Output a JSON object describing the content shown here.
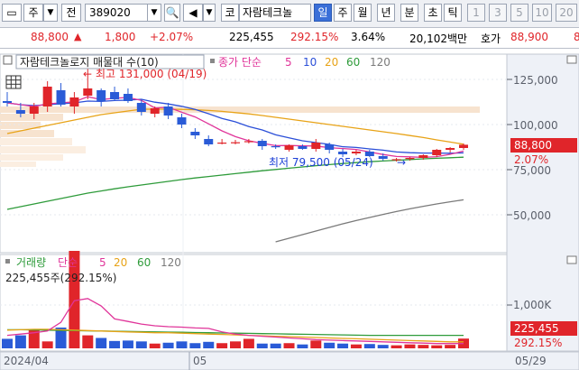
{
  "toolbar": {
    "market": "주",
    "market_sub": "전",
    "code": "389020",
    "name": "자람테크놀",
    "periods": [
      "일",
      "주",
      "월",
      "년",
      "분",
      "초",
      "틱"
    ],
    "selected_period": "일",
    "kind_label": "코",
    "minutes": [
      "1",
      "3",
      "5",
      "10",
      "20"
    ]
  },
  "quote": {
    "price": "88,800",
    "change": "1,800",
    "change_pct": "+2.07%",
    "volume": "225,455",
    "volume_ratio": "292.15%",
    "turnover": "3.64%",
    "amount": "20,102백만",
    "ask_label": "호가",
    "ask_price": "88,900",
    "ask_tail": "8"
  },
  "price_panel": {
    "title": "자람테크놀로지 매물대 수(10)",
    "ma_label": "종가 단순",
    "ma_periods": [
      "5",
      "10",
      "20",
      "60",
      "120"
    ],
    "high_note": "최고 131,000 (04/19)",
    "low_note": "최저 79,500 (05/24)",
    "last_price": "88,800",
    "last_pct": "2.07%",
    "y_ticks": [
      "125,000",
      "100,000",
      "75,000",
      "50,000"
    ]
  },
  "volume_panel": {
    "title": "거래량",
    "ma_label": "단순",
    "ma_periods": [
      "5",
      "20",
      "60",
      "120"
    ],
    "summary": "225,455주(292.15%)",
    "y_tick": "1,000K",
    "last_volume": "225,455",
    "last_pct": "292.15%"
  },
  "x_axis": {
    "labels": [
      "2024/04",
      "05",
      "05/29"
    ]
  },
  "colors": {
    "up": "#e0252a",
    "down": "#2a5bd7",
    "ma5": "#e0359a",
    "ma10": "#2b4fd8",
    "ma20": "#e8a317",
    "ma60": "#2e9b3a",
    "ma120": "#7a7a7a"
  },
  "chart_data": {
    "type": "candlestick",
    "candles": [
      {
        "o": 113000,
        "h": 118000,
        "l": 110000,
        "c": 112000
      },
      {
        "o": 108000,
        "h": 112000,
        "l": 104000,
        "c": 106000
      },
      {
        "o": 106000,
        "h": 112000,
        "l": 103000,
        "c": 110000
      },
      {
        "o": 110000,
        "h": 124000,
        "l": 107000,
        "c": 121000
      },
      {
        "o": 119000,
        "h": 123000,
        "l": 110000,
        "c": 111000
      },
      {
        "o": 110000,
        "h": 118000,
        "l": 106000,
        "c": 115000
      },
      {
        "o": 116000,
        "h": 131000,
        "l": 114000,
        "c": 120000
      },
      {
        "o": 119000,
        "h": 120000,
        "l": 110000,
        "c": 113000
      },
      {
        "o": 118000,
        "h": 121000,
        "l": 113000,
        "c": 114000
      },
      {
        "o": 117000,
        "h": 120000,
        "l": 112000,
        "c": 113000
      },
      {
        "o": 112000,
        "h": 114000,
        "l": 105000,
        "c": 107000
      },
      {
        "o": 106000,
        "h": 110000,
        "l": 104000,
        "c": 109000
      },
      {
        "o": 110000,
        "h": 112000,
        "l": 103000,
        "c": 105000
      },
      {
        "o": 104000,
        "h": 106000,
        "l": 98000,
        "c": 100000
      },
      {
        "o": 96000,
        "h": 98000,
        "l": 92000,
        "c": 94000
      },
      {
        "o": 92000,
        "h": 94000,
        "l": 88000,
        "c": 89000
      },
      {
        "o": 90000,
        "h": 92000,
        "l": 89000,
        "c": 90000
      },
      {
        "o": 90000,
        "h": 91500,
        "l": 89000,
        "c": 90200
      },
      {
        "o": 90500,
        "h": 92000,
        "l": 89500,
        "c": 90800
      },
      {
        "o": 91000,
        "h": 92000,
        "l": 86000,
        "c": 88000
      },
      {
        "o": 88000,
        "h": 89000,
        "l": 86500,
        "c": 87500
      },
      {
        "o": 86000,
        "h": 89000,
        "l": 85000,
        "c": 88500
      },
      {
        "o": 88000,
        "h": 89000,
        "l": 86000,
        "c": 86500
      },
      {
        "o": 86500,
        "h": 92000,
        "l": 85000,
        "c": 90000
      },
      {
        "o": 89000,
        "h": 90000,
        "l": 84000,
        "c": 86000
      },
      {
        "o": 85000,
        "h": 86500,
        "l": 82000,
        "c": 83500
      },
      {
        "o": 84000,
        "h": 86000,
        "l": 83000,
        "c": 85000
      },
      {
        "o": 85000,
        "h": 86000,
        "l": 82000,
        "c": 82500
      },
      {
        "o": 82500,
        "h": 84000,
        "l": 80000,
        "c": 81000
      },
      {
        "o": 80500,
        "h": 81500,
        "l": 79500,
        "c": 80800
      },
      {
        "o": 81000,
        "h": 82000,
        "l": 80000,
        "c": 81500
      },
      {
        "o": 81500,
        "h": 83500,
        "l": 80500,
        "c": 83000
      },
      {
        "o": 83000,
        "h": 86500,
        "l": 82000,
        "c": 86000
      },
      {
        "o": 86000,
        "h": 87500,
        "l": 84500,
        "c": 87000
      },
      {
        "o": 87000,
        "h": 89500,
        "l": 86000,
        "c": 88800
      }
    ],
    "ma5": [
      112000,
      111000,
      110000,
      111500,
      112000,
      112600,
      115400,
      113800,
      114600,
      115000,
      113400,
      109200,
      109600,
      106800,
      104200,
      100400,
      96500,
      93300,
      91000,
      89600,
      88300,
      88400,
      88200,
      88100,
      87200,
      86700,
      86200,
      84800,
      83400,
      82300,
      82100,
      81800,
      82200,
      83500,
      85300
    ],
    "ma10": [
      112000,
      111000,
      110500,
      111000,
      111500,
      112000,
      113000,
      112800,
      113300,
      113500,
      114000,
      112400,
      111400,
      110100,
      108400,
      106000,
      103400,
      101500,
      98900,
      97000,
      94300,
      92600,
      91000,
      90000,
      89000,
      87700,
      87300,
      86500,
      85800,
      84800,
      84400,
      84200,
      84200,
      84100,
      84300
    ],
    "ma20": [
      95000,
      96500,
      98000,
      99500,
      101000,
      102500,
      104000,
      105500,
      106500,
      107500,
      108500,
      108500,
      108500,
      108400,
      108200,
      107800,
      107300,
      106600,
      105900,
      105000,
      104000,
      103000,
      102000,
      101000,
      100000,
      99000,
      98000,
      97000,
      96000,
      95000,
      93900,
      92800,
      91500,
      90300,
      89100
    ],
    "ma60": [
      53000,
      54500,
      56000,
      57500,
      59000,
      60500,
      62000,
      63200,
      64400,
      65500,
      66500,
      67500,
      68500,
      69500,
      70400,
      71200,
      72000,
      72800,
      73600,
      74400,
      75100,
      75800,
      76500,
      77200,
      77800,
      78400,
      78900,
      79400,
      79800,
      80200,
      80600,
      81000,
      81300,
      81600,
      81900
    ],
    "ma120": [
      null,
      null,
      null,
      null,
      null,
      null,
      null,
      null,
      null,
      null,
      null,
      null,
      null,
      null,
      null,
      null,
      null,
      null,
      null,
      null,
      35000,
      37000,
      39000,
      41000,
      43000,
      45000,
      46800,
      48500,
      50200,
      51800,
      53300,
      54700,
      56000,
      57200,
      58300
    ],
    "volume": [
      220000,
      300000,
      420000,
      160000,
      480000,
      2250000,
      300000,
      240000,
      170000,
      180000,
      160000,
      110000,
      130000,
      160000,
      120000,
      150000,
      120000,
      160000,
      220000,
      110000,
      110000,
      120000,
      90000,
      180000,
      130000,
      110000,
      90000,
      100000,
      80000,
      70000,
      90000,
      80000,
      70000,
      80000,
      225455
    ],
    "vol_ma5": [
      300000,
      330000,
      360000,
      400000,
      600000,
      1100000,
      1150000,
      980000,
      680000,
      620000,
      560000,
      520000,
      500000,
      490000,
      470000,
      460000,
      380000,
      330000,
      300000,
      280000,
      260000,
      240000,
      220000,
      200000,
      190000,
      180000,
      170000,
      160000,
      150000,
      140000,
      130000,
      120000,
      110000,
      110000,
      110000
    ],
    "vol_ma20": [
      420000,
      430000,
      440000,
      440000,
      430000,
      420000,
      410000,
      400000,
      390000,
      380000,
      370000,
      360000,
      360000,
      350000,
      340000,
      330000,
      320000,
      310000,
      300000,
      290000,
      280000,
      270000,
      260000,
      250000,
      240000,
      230000,
      220000,
      210000,
      200000,
      190000,
      180000,
      170000,
      160000,
      150000,
      150000
    ],
    "vol_ma60": [
      430000,
      430000,
      425000,
      420000,
      415000,
      410000,
      405000,
      400000,
      395000,
      390000,
      385000,
      380000,
      375000,
      370000,
      365000,
      360000,
      355000,
      350000,
      345000,
      340000,
      335000,
      330000,
      325000,
      320000,
      315000,
      310000,
      305000,
      300000,
      300000,
      300000,
      300000,
      300000,
      300000,
      300000,
      300000
    ],
    "ylim_price": [
      40000,
      140000
    ],
    "ylim_volume": [
      0,
      2400000
    ]
  }
}
